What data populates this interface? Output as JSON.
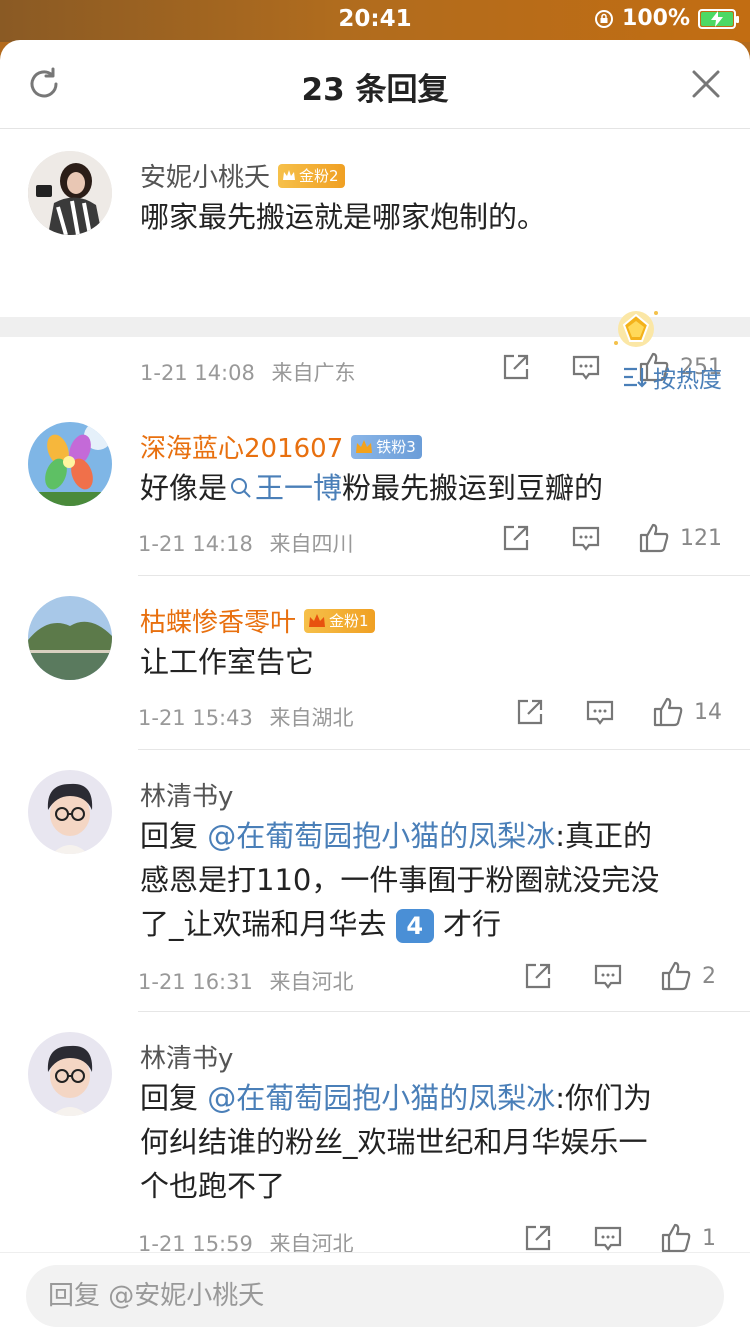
{
  "status": {
    "time": "20:41",
    "battery": "100%",
    "battery_level": 1.0
  },
  "header": {
    "title": "23 条回复"
  },
  "original": {
    "user": "安妮小桃夭",
    "badge": "金粉2",
    "text": "哪家最先搬运就是哪家炮制的。",
    "time": "1-21 14:08",
    "location": "来自广东",
    "likes": "251"
  },
  "sort_label": "按热度",
  "replies": [
    {
      "user": "深海蓝心201607",
      "badge": "铁粉3",
      "text_pre": "好像是",
      "keyword": "王一博",
      "text_post": "粉最先搬运到豆瓣的",
      "time": "1-21 14:18",
      "location": "来自四川",
      "likes": "121"
    },
    {
      "user": "枯蝶惨香零叶",
      "badge": "金粉1",
      "text": "让工作室告它",
      "time": "1-21 15:43",
      "location": "来自湖北",
      "likes": "14"
    },
    {
      "user": "林清书y",
      "reply_prefix": "回复 ",
      "mention": "@在葡萄园抱小猫的凤梨冰",
      "line1_post": ":真正的",
      "line2": "感恩是打110，一件事囿于粉圈就没完没",
      "line3_pre": "了_让欢瑞和月华去",
      "emoji": "4",
      "line3_post": "才行",
      "time": "1-21 16:31",
      "location": "来自河北",
      "likes": "2"
    },
    {
      "user": "林清书y",
      "reply_prefix": "回复 ",
      "mention": "@在葡萄园抱小猫的凤梨冰",
      "line1_post": ":你们为",
      "line2": "何纠结谁的粉丝_欢瑞世纪和月华娱乐一",
      "line3": "个也跑不了",
      "time": "1-21 15:59",
      "location": "来自河北",
      "likes": "1"
    }
  ],
  "input": {
    "placeholder": "回复 @安妮小桃夭"
  }
}
